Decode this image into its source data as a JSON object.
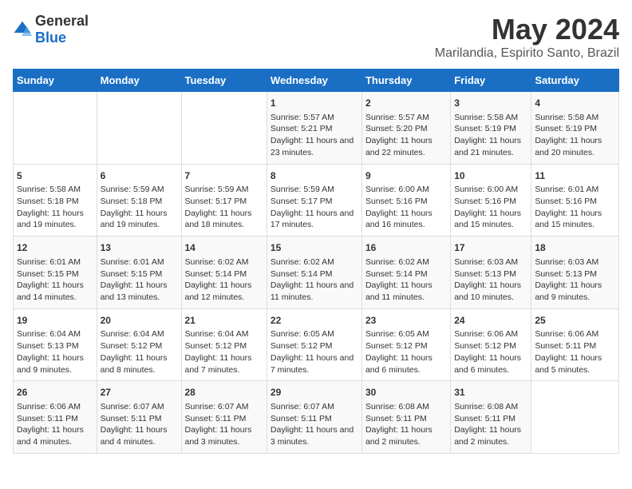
{
  "logo": {
    "general": "General",
    "blue": "Blue"
  },
  "title": "May 2024",
  "subtitle": "Marilandia, Espirito Santo, Brazil",
  "days_header": [
    "Sunday",
    "Monday",
    "Tuesday",
    "Wednesday",
    "Thursday",
    "Friday",
    "Saturday"
  ],
  "weeks": [
    [
      {
        "day": "",
        "info": ""
      },
      {
        "day": "",
        "info": ""
      },
      {
        "day": "",
        "info": ""
      },
      {
        "day": "1",
        "info": "Sunrise: 5:57 AM\nSunset: 5:21 PM\nDaylight: 11 hours and 23 minutes."
      },
      {
        "day": "2",
        "info": "Sunrise: 5:57 AM\nSunset: 5:20 PM\nDaylight: 11 hours and 22 minutes."
      },
      {
        "day": "3",
        "info": "Sunrise: 5:58 AM\nSunset: 5:19 PM\nDaylight: 11 hours and 21 minutes."
      },
      {
        "day": "4",
        "info": "Sunrise: 5:58 AM\nSunset: 5:19 PM\nDaylight: 11 hours and 20 minutes."
      }
    ],
    [
      {
        "day": "5",
        "info": "Sunrise: 5:58 AM\nSunset: 5:18 PM\nDaylight: 11 hours and 19 minutes."
      },
      {
        "day": "6",
        "info": "Sunrise: 5:59 AM\nSunset: 5:18 PM\nDaylight: 11 hours and 19 minutes."
      },
      {
        "day": "7",
        "info": "Sunrise: 5:59 AM\nSunset: 5:17 PM\nDaylight: 11 hours and 18 minutes."
      },
      {
        "day": "8",
        "info": "Sunrise: 5:59 AM\nSunset: 5:17 PM\nDaylight: 11 hours and 17 minutes."
      },
      {
        "day": "9",
        "info": "Sunrise: 6:00 AM\nSunset: 5:16 PM\nDaylight: 11 hours and 16 minutes."
      },
      {
        "day": "10",
        "info": "Sunrise: 6:00 AM\nSunset: 5:16 PM\nDaylight: 11 hours and 15 minutes."
      },
      {
        "day": "11",
        "info": "Sunrise: 6:01 AM\nSunset: 5:16 PM\nDaylight: 11 hours and 15 minutes."
      }
    ],
    [
      {
        "day": "12",
        "info": "Sunrise: 6:01 AM\nSunset: 5:15 PM\nDaylight: 11 hours and 14 minutes."
      },
      {
        "day": "13",
        "info": "Sunrise: 6:01 AM\nSunset: 5:15 PM\nDaylight: 11 hours and 13 minutes."
      },
      {
        "day": "14",
        "info": "Sunrise: 6:02 AM\nSunset: 5:14 PM\nDaylight: 11 hours and 12 minutes."
      },
      {
        "day": "15",
        "info": "Sunrise: 6:02 AM\nSunset: 5:14 PM\nDaylight: 11 hours and 11 minutes."
      },
      {
        "day": "16",
        "info": "Sunrise: 6:02 AM\nSunset: 5:14 PM\nDaylight: 11 hours and 11 minutes."
      },
      {
        "day": "17",
        "info": "Sunrise: 6:03 AM\nSunset: 5:13 PM\nDaylight: 11 hours and 10 minutes."
      },
      {
        "day": "18",
        "info": "Sunrise: 6:03 AM\nSunset: 5:13 PM\nDaylight: 11 hours and 9 minutes."
      }
    ],
    [
      {
        "day": "19",
        "info": "Sunrise: 6:04 AM\nSunset: 5:13 PM\nDaylight: 11 hours and 9 minutes."
      },
      {
        "day": "20",
        "info": "Sunrise: 6:04 AM\nSunset: 5:12 PM\nDaylight: 11 hours and 8 minutes."
      },
      {
        "day": "21",
        "info": "Sunrise: 6:04 AM\nSunset: 5:12 PM\nDaylight: 11 hours and 7 minutes."
      },
      {
        "day": "22",
        "info": "Sunrise: 6:05 AM\nSunset: 5:12 PM\nDaylight: 11 hours and 7 minutes."
      },
      {
        "day": "23",
        "info": "Sunrise: 6:05 AM\nSunset: 5:12 PM\nDaylight: 11 hours and 6 minutes."
      },
      {
        "day": "24",
        "info": "Sunrise: 6:06 AM\nSunset: 5:12 PM\nDaylight: 11 hours and 6 minutes."
      },
      {
        "day": "25",
        "info": "Sunrise: 6:06 AM\nSunset: 5:11 PM\nDaylight: 11 hours and 5 minutes."
      }
    ],
    [
      {
        "day": "26",
        "info": "Sunrise: 6:06 AM\nSunset: 5:11 PM\nDaylight: 11 hours and 4 minutes."
      },
      {
        "day": "27",
        "info": "Sunrise: 6:07 AM\nSunset: 5:11 PM\nDaylight: 11 hours and 4 minutes."
      },
      {
        "day": "28",
        "info": "Sunrise: 6:07 AM\nSunset: 5:11 PM\nDaylight: 11 hours and 3 minutes."
      },
      {
        "day": "29",
        "info": "Sunrise: 6:07 AM\nSunset: 5:11 PM\nDaylight: 11 hours and 3 minutes."
      },
      {
        "day": "30",
        "info": "Sunrise: 6:08 AM\nSunset: 5:11 PM\nDaylight: 11 hours and 2 minutes."
      },
      {
        "day": "31",
        "info": "Sunrise: 6:08 AM\nSunset: 5:11 PM\nDaylight: 11 hours and 2 minutes."
      },
      {
        "day": "",
        "info": ""
      }
    ]
  ]
}
